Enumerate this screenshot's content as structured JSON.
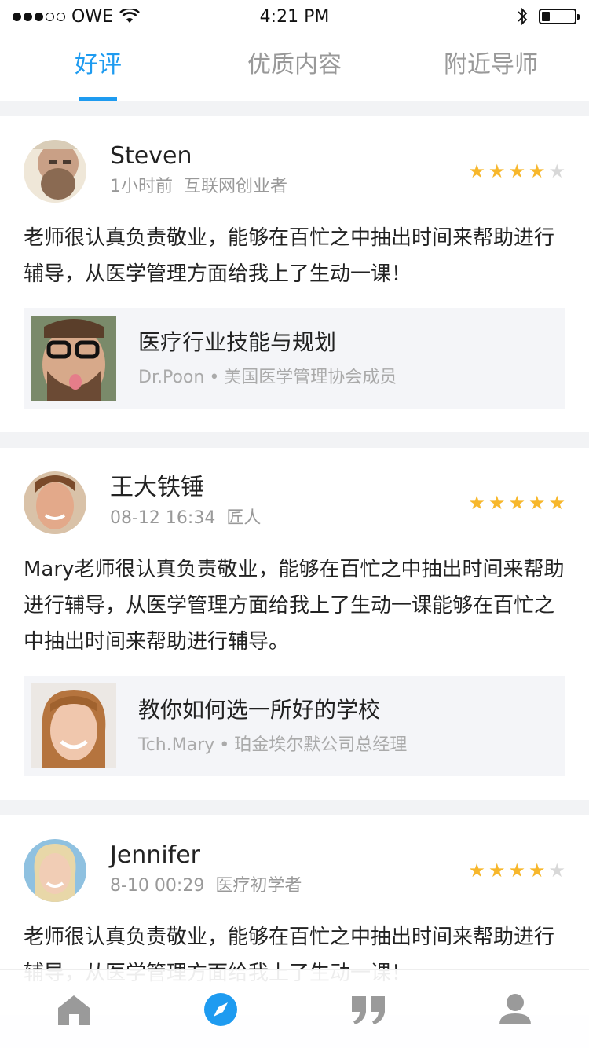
{
  "status_bar": {
    "carrier": "OWE",
    "time": "4:21 PM"
  },
  "tabs": [
    {
      "label": "好评",
      "active": true
    },
    {
      "label": "优质内容",
      "active": false
    },
    {
      "label": "附近导师",
      "active": false
    }
  ],
  "reviews": [
    {
      "name": "Steven",
      "time": "1小时前",
      "role": "互联网创业者",
      "rating": 4,
      "comment": "老师很认真负责敬业，能够在百忙之中抽出时间来帮助进行辅导，从医学管理方面给我上了生动一课！",
      "course": {
        "title": "医疗行业技能与规划",
        "mentor": "Dr.Poon",
        "dot": "•",
        "mentor_title": "美国医学管理协会成员"
      }
    },
    {
      "name": "王大铁锤",
      "time": "08-12 16:34",
      "role": "匠人",
      "rating": 5,
      "comment": "Mary老师很认真负责敬业，能够在百忙之中抽出时间来帮助进行辅导，从医学管理方面给我上了生动一课能够在百忙之中抽出时间来帮助进行辅导。",
      "course": {
        "title": "教你如何选一所好的学校",
        "mentor": "Tch.Mary",
        "dot": "•",
        "mentor_title": "珀金埃尔默公司总经理"
      }
    },
    {
      "name": "Jennifer",
      "time": "8-10 00:29",
      "role": "医疗初学者",
      "rating": 4,
      "comment": "老师很认真负责敬业，能够在百忙之中抽出时间来帮助进行辅导，从医学管理方面给我上了生动一课！"
    }
  ],
  "tab_bar": [
    {
      "icon": "home-icon",
      "active": false
    },
    {
      "icon": "compass-icon",
      "active": true
    },
    {
      "icon": "quote-icon",
      "active": false
    },
    {
      "icon": "user-icon",
      "active": false
    }
  ],
  "colors": {
    "accent": "#1e9bf0",
    "star": "#f7b72b",
    "star_off": "#d8d8d8",
    "inactive_icon": "#9a9a9a"
  }
}
